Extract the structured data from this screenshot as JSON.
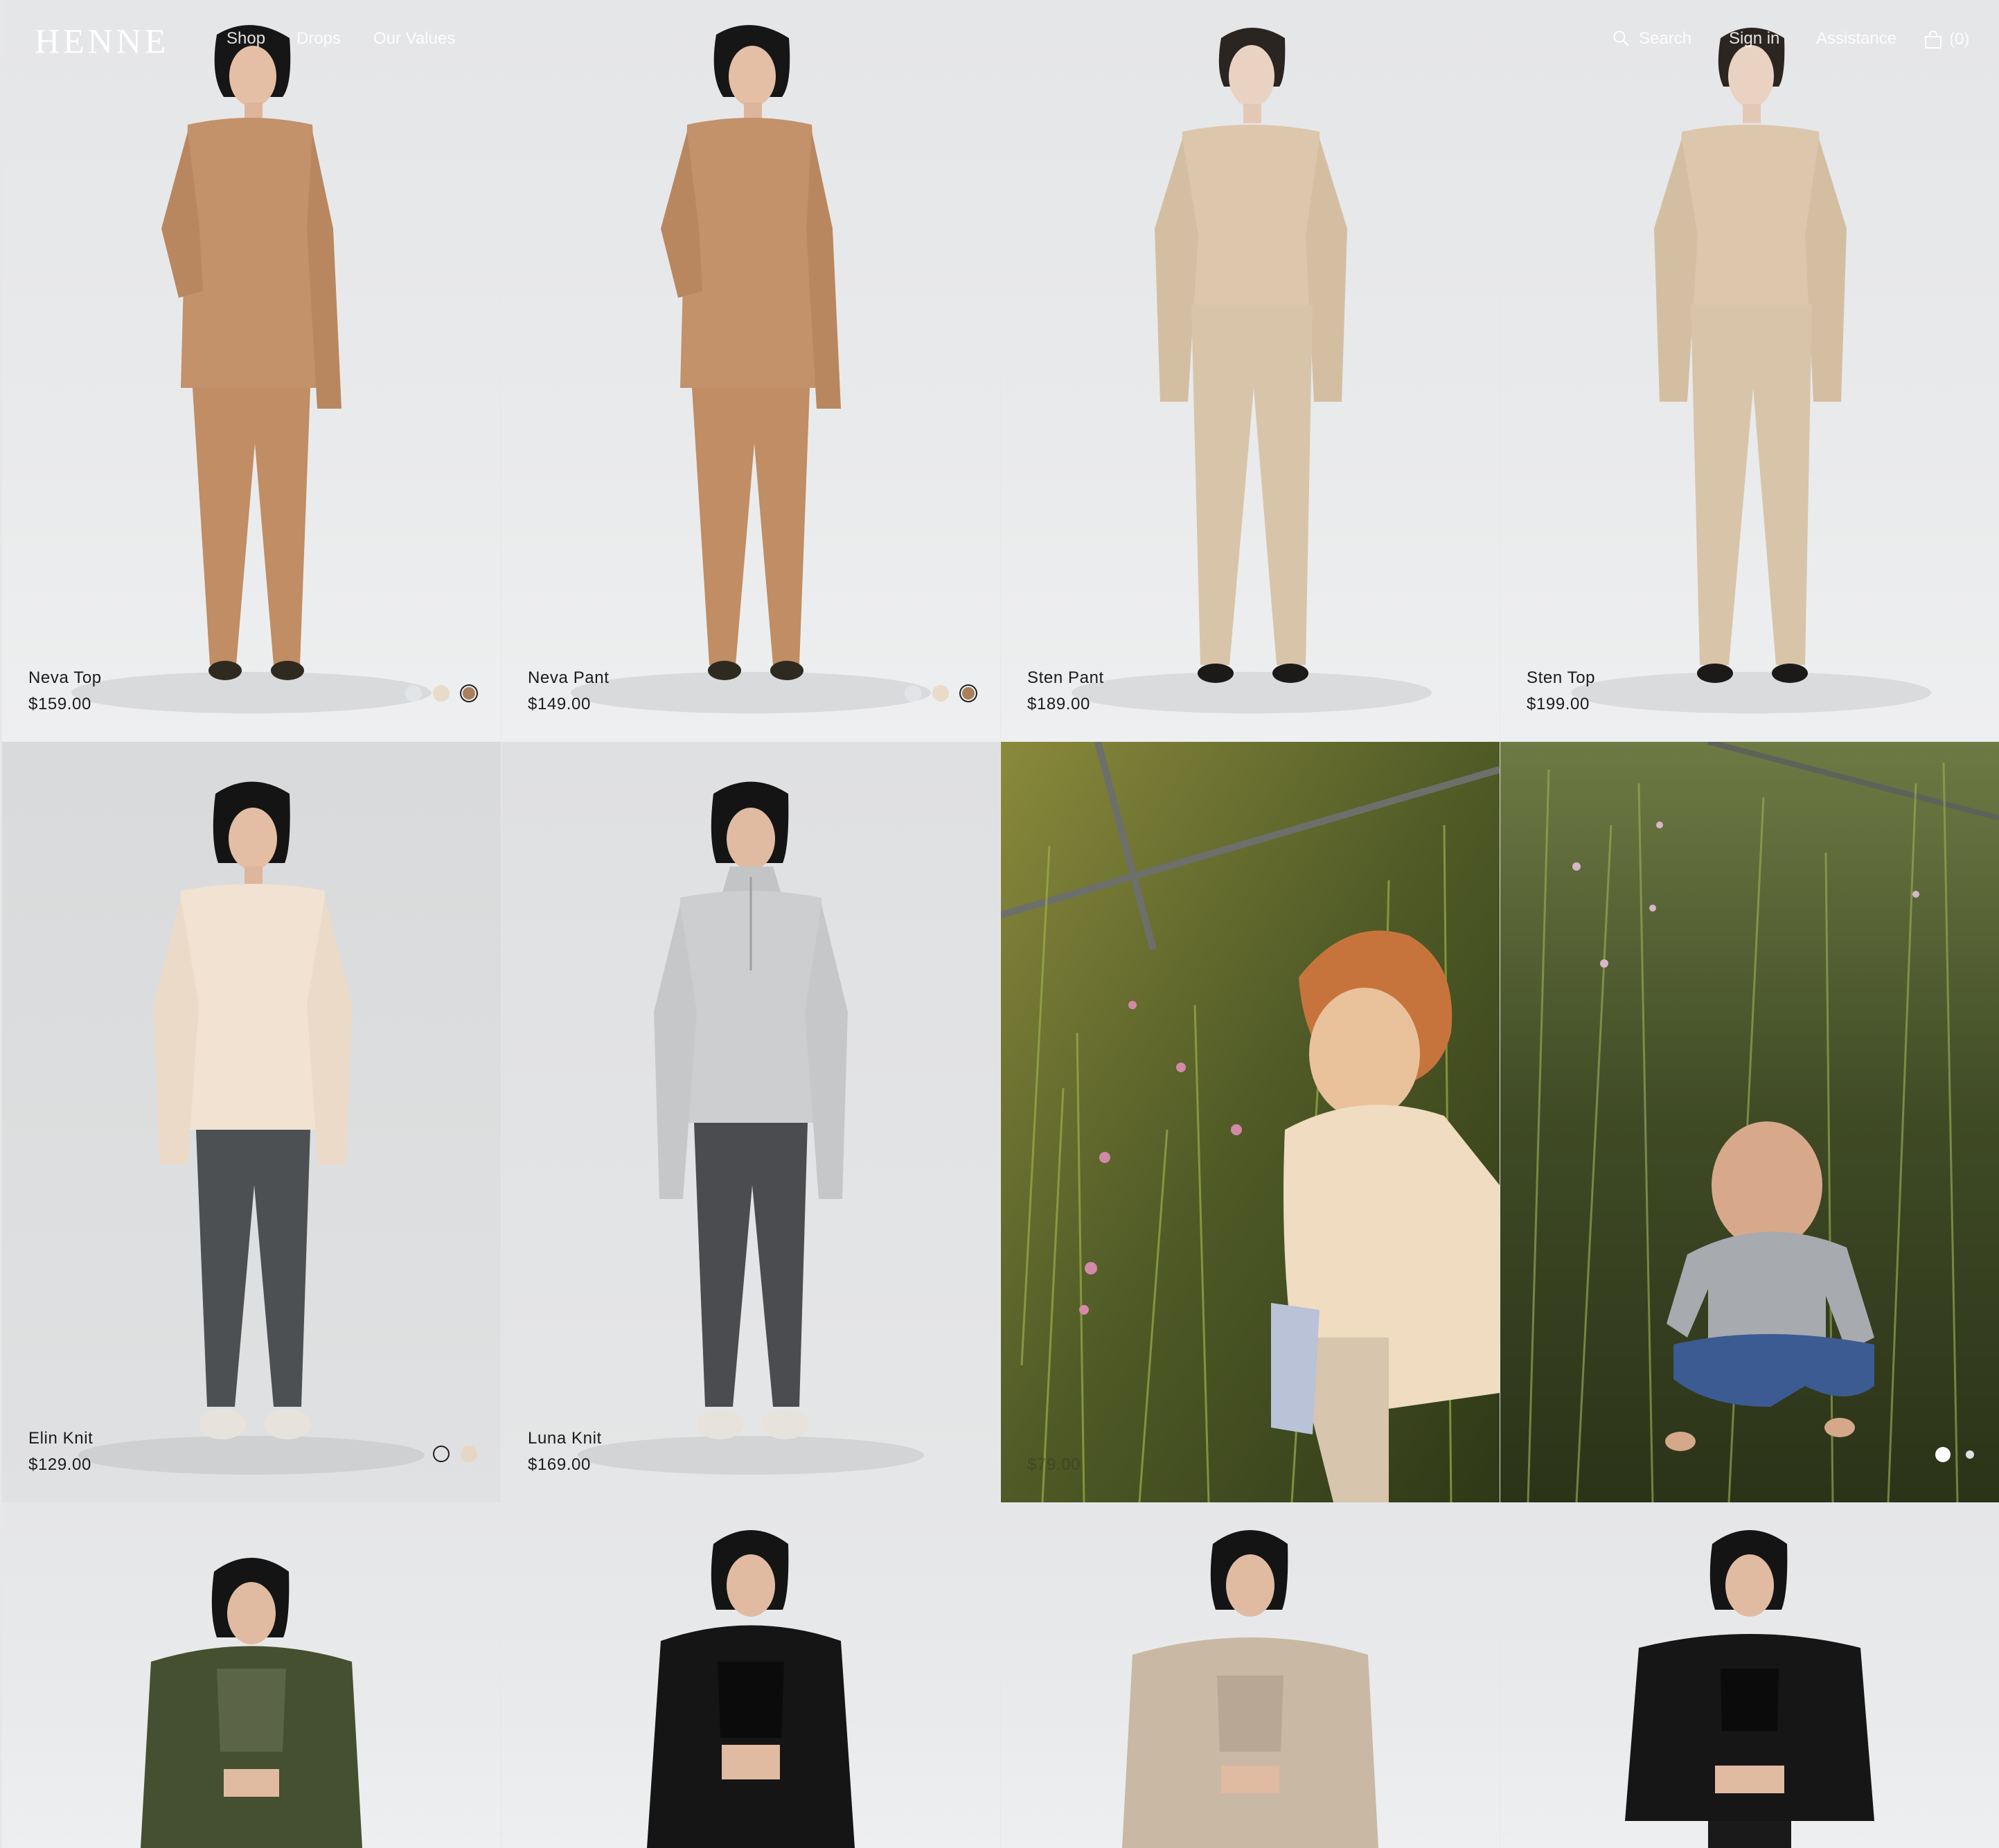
{
  "header": {
    "logo": "HENNE",
    "nav": [
      "Shop",
      "Drops",
      "Our Values"
    ],
    "search_label": "Search",
    "signin_label": "Sign in",
    "assistance_label": "Assistance",
    "bag_count": "(0)"
  },
  "products": [
    {
      "name": "Neva Top",
      "price": "$159.00",
      "swatches": [
        "#e2e5e8",
        "#e8dcc8",
        "#a97f5c"
      ],
      "selected_swatch": 2
    },
    {
      "name": "Neva Pant",
      "price": "$149.00",
      "swatches": [
        "#e2e5e8",
        "#e8dcc8",
        "#a97f5c"
      ],
      "selected_swatch": 2
    },
    {
      "name": "Sten Pant",
      "price": "$189.00"
    },
    {
      "name": "Sten Top",
      "price": "$199.00"
    },
    {
      "name": "Elin Knit",
      "price": "$129.00",
      "swatches": [
        "ring",
        "#e8d6c4"
      ]
    },
    {
      "name": "Luna Knit",
      "price": "$169.00"
    }
  ],
  "lifestyle": {
    "partial_price": "$79.00",
    "carousel_dots": 2
  },
  "colors": {
    "text": "#1b1b1b",
    "studio_bg": "#e8e9ea",
    "tan_knit": "#c3916a",
    "oat_knit": "#dcc7ac"
  }
}
